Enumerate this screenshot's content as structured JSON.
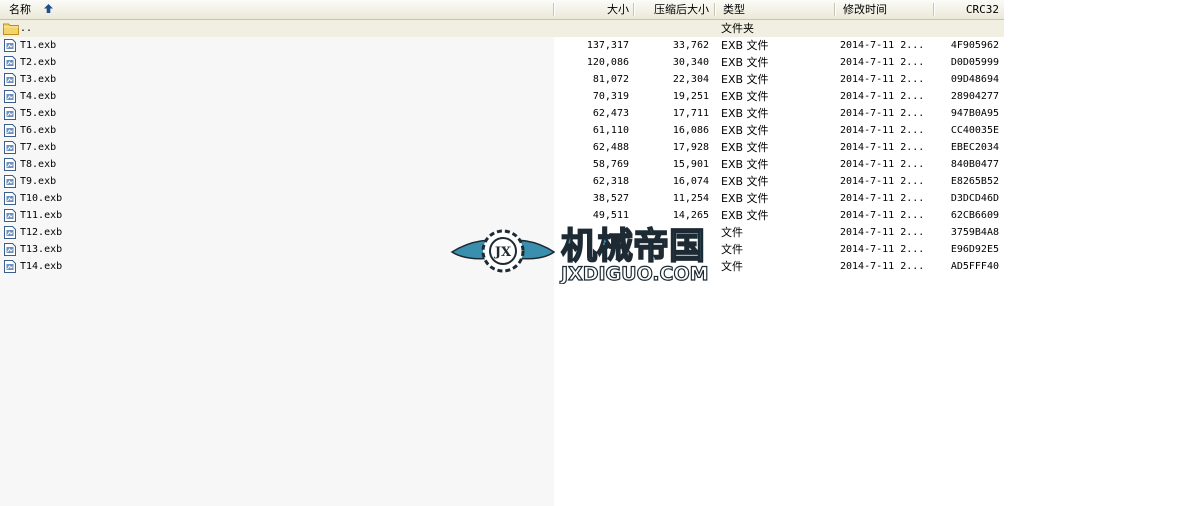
{
  "columns": {
    "name": "名称",
    "size": "大小",
    "packed": "压缩后大小",
    "type": "类型",
    "modified": "修改时间",
    "crc": "CRC32"
  },
  "sort_icon": "sort-up-arrow-icon",
  "parent_row": {
    "name": "..",
    "type": "文件夹",
    "icon": "folder-icon"
  },
  "files": [
    {
      "name": "T1.exb",
      "size": "137,317",
      "packed": "33,762",
      "type": "EXB 文件",
      "modified": "2014-7-11 2...",
      "crc": "4F905962"
    },
    {
      "name": "T2.exb",
      "size": "120,086",
      "packed": "30,340",
      "type": "EXB 文件",
      "modified": "2014-7-11 2...",
      "crc": "D0D05999"
    },
    {
      "name": "T3.exb",
      "size": "81,072",
      "packed": "22,304",
      "type": "EXB 文件",
      "modified": "2014-7-11 2...",
      "crc": "09D48694"
    },
    {
      "name": "T4.exb",
      "size": "70,319",
      "packed": "19,251",
      "type": "EXB 文件",
      "modified": "2014-7-11 2...",
      "crc": "28904277"
    },
    {
      "name": "T5.exb",
      "size": "62,473",
      "packed": "17,711",
      "type": "EXB 文件",
      "modified": "2014-7-11 2...",
      "crc": "947B0A95"
    },
    {
      "name": "T6.exb",
      "size": "61,110",
      "packed": "16,086",
      "type": "EXB 文件",
      "modified": "2014-7-11 2...",
      "crc": "CC40035E"
    },
    {
      "name": "T7.exb",
      "size": "62,488",
      "packed": "17,928",
      "type": "EXB 文件",
      "modified": "2014-7-11 2...",
      "crc": "EBEC2034"
    },
    {
      "name": "T8.exb",
      "size": "58,769",
      "packed": "15,901",
      "type": "EXB 文件",
      "modified": "2014-7-11 2...",
      "crc": "840B0477"
    },
    {
      "name": "T9.exb",
      "size": "62,318",
      "packed": "16,074",
      "type": "EXB 文件",
      "modified": "2014-7-11 2...",
      "crc": "E8265B52"
    },
    {
      "name": "T10.exb",
      "size": "38,527",
      "packed": "11,254",
      "type": "EXB 文件",
      "modified": "2014-7-11 2...",
      "crc": "D3DCD46D"
    },
    {
      "name": "T11.exb",
      "size": "49,511",
      "packed": "14,265",
      "type": "EXB 文件",
      "modified": "2014-7-11 2...",
      "crc": "62CB6609"
    },
    {
      "name": "T12.exb",
      "size": "",
      "packed": "",
      "type": "文件",
      "modified": "2014-7-11 2...",
      "crc": "3759B4A8"
    },
    {
      "name": "T13.exb",
      "size": "",
      "packed": "",
      "type": "文件",
      "modified": "2014-7-11 2...",
      "crc": "E96D92E5"
    },
    {
      "name": "T14.exb",
      "size": "",
      "packed": "",
      "type": "文件",
      "modified": "2014-7-11 2...",
      "crc": "AD5FFF40"
    }
  ],
  "file_icon": "exb-file-icon",
  "watermark": {
    "badge_text": "JX",
    "title": "机械帝国",
    "url": "JXDIGUO.COM",
    "icon": "winged-gear-logo-icon",
    "color": "#3b8fae"
  }
}
